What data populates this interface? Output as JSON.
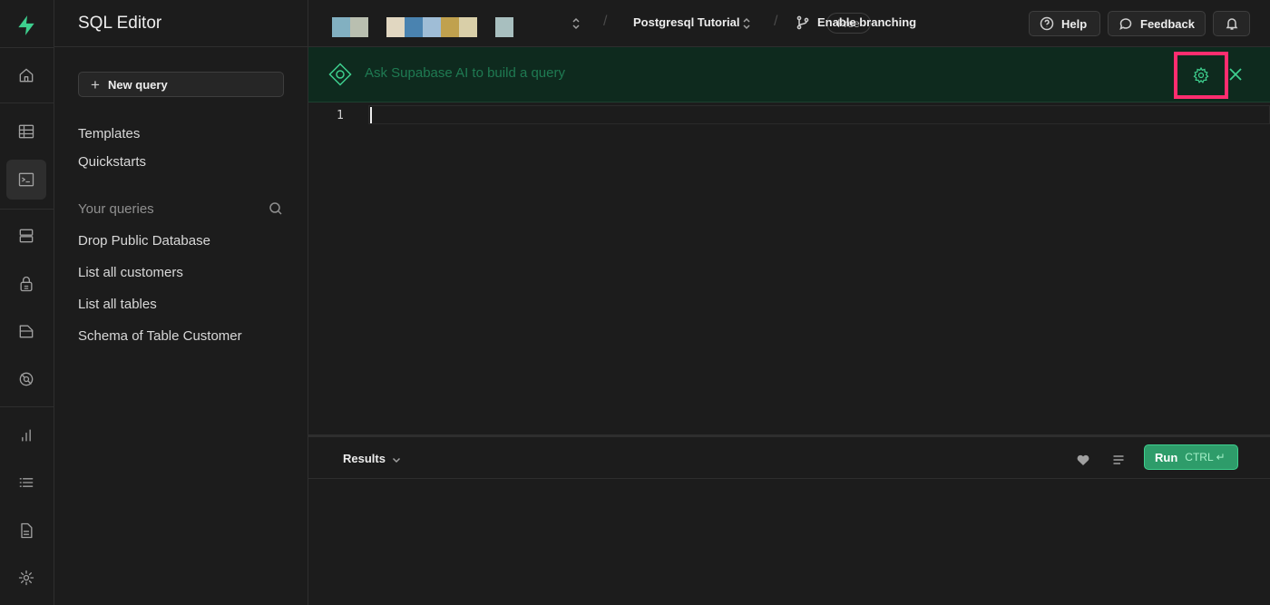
{
  "sidebar": {
    "title": "SQL Editor",
    "new_query_label": "New query",
    "links": [
      "Templates",
      "Quickstarts"
    ],
    "section_label": "Your queries",
    "queries": [
      "Drop Public Database",
      "List all customers",
      "List all tables",
      "Schema of Table Customer"
    ]
  },
  "topbar": {
    "plan_badge": "Free",
    "project_name": "Postgresql Tutorial",
    "branch_label": "Enable branching",
    "help_label": "Help",
    "feedback_label": "Feedback",
    "org_swatch_colors": [
      "#82b0c1",
      "#b9bfb0",
      "#e1d7c1",
      "#4a83b0",
      "#9fbdd6",
      "#c0a14e",
      "#d9cfa8",
      "#a8bfbf"
    ]
  },
  "ai_bar": {
    "placeholder": "Ask Supabase AI to build a query"
  },
  "editor": {
    "line_number": "1"
  },
  "results": {
    "label": "Results",
    "run_label": "Run",
    "run_shortcut": "CTRL ↵"
  },
  "colors": {
    "accent": "#3ecf8e",
    "highlight_box": "#ff2d6f",
    "ai_bar_bg": "#0e2a1e"
  }
}
